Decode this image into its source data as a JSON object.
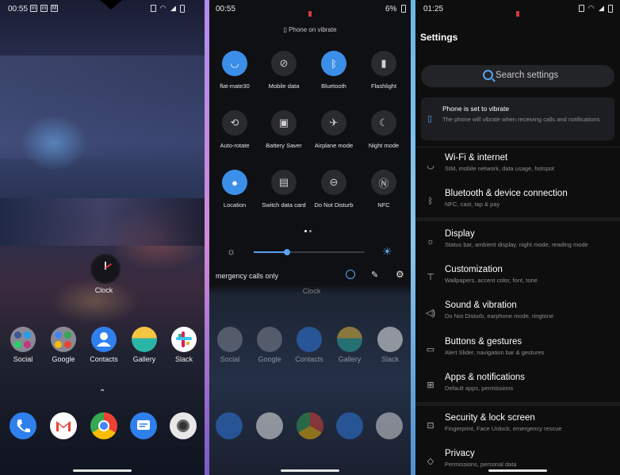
{
  "home": {
    "status": {
      "time": "00:55",
      "icons": [
        "linkedin-icon",
        "linkedin-icon",
        "gmail-icon"
      ]
    },
    "clock_label": "Clock",
    "apps": [
      {
        "label": "Social",
        "icon": "social-folder-icon"
      },
      {
        "label": "Google",
        "icon": "google-folder-icon"
      },
      {
        "label": "Contacts",
        "icon": "contacts-icon"
      },
      {
        "label": "Gallery",
        "icon": "gallery-icon"
      },
      {
        "label": "Slack",
        "icon": "slack-icon"
      }
    ],
    "dock": [
      "phone-icon",
      "gmail-icon",
      "chrome-icon",
      "messages-icon",
      "camera-icon"
    ],
    "swipe_glyph": "⌃"
  },
  "quick_settings": {
    "status": {
      "time": "00:55",
      "battery": "6%"
    },
    "vibrate_label": "Phone on vibrate",
    "tiles": [
      {
        "label": "flat-mate30",
        "on": true,
        "icon": "wifi-icon"
      },
      {
        "label": "Mobile data",
        "on": false,
        "icon": "mobile-data-icon"
      },
      {
        "label": "Bluetooth",
        "on": true,
        "icon": "bluetooth-icon"
      },
      {
        "label": "Flashlight",
        "on": false,
        "icon": "flashlight-icon"
      },
      {
        "label": "Auto-rotate",
        "on": false,
        "icon": "auto-rotate-icon"
      },
      {
        "label": "Battery Saver",
        "on": false,
        "icon": "battery-saver-icon"
      },
      {
        "label": "Airplane mode",
        "on": false,
        "icon": "airplane-icon"
      },
      {
        "label": "Night mode",
        "on": false,
        "icon": "night-mode-icon"
      },
      {
        "label": "Location",
        "on": true,
        "icon": "location-icon"
      },
      {
        "label": "Switch data card",
        "on": false,
        "icon": "sim-card-icon"
      },
      {
        "label": "Do Not Disturb",
        "on": false,
        "icon": "do-not-disturb-icon"
      },
      {
        "label": "NFC",
        "on": false,
        "icon": "nfc-icon"
      }
    ],
    "brightness_level": 0.3,
    "emergency_text": "mergency calls only",
    "clock_label": "Clock",
    "apps": [
      "Social",
      "Google",
      "Contacts",
      "Gallery",
      "Slack"
    ]
  },
  "settings": {
    "status": {
      "time": "01:25"
    },
    "title": "Settings",
    "search_placeholder": "Search settings",
    "vibrate_card": {
      "title": "Phone is set to vibrate",
      "subtitle": "The phone will vibrate when receiving calls and notifications"
    },
    "items": [
      {
        "title": "Wi-Fi & internet",
        "subtitle": "SIM, mobile network, data usage, hotspot",
        "icon": "wifi-icon"
      },
      {
        "title": "Bluetooth & device connection",
        "subtitle": "NFC, cast, tap & pay",
        "icon": "bluetooth-icon"
      },
      {
        "title": "Display",
        "subtitle": "Status bar, ambient display, night mode, reading mode",
        "icon": "brightness-icon"
      },
      {
        "title": "Customization",
        "subtitle": "Wallpapers, accent color, font, tone",
        "icon": "shirt-icon"
      },
      {
        "title": "Sound & vibration",
        "subtitle": "Do Not Disturb, earphone mode, ringtone",
        "icon": "speaker-icon"
      },
      {
        "title": "Buttons & gestures",
        "subtitle": "Alert Slider, navigation bar & gestures",
        "icon": "buttons-icon"
      },
      {
        "title": "Apps & notifications",
        "subtitle": "Default apps, permissions",
        "icon": "apps-grid-icon"
      },
      {
        "title": "Security & lock screen",
        "subtitle": "Fingerprint, Face Unlock, emergency rescue",
        "icon": "lock-icon"
      },
      {
        "title": "Privacy",
        "subtitle": "Permissions, personal data",
        "icon": "privacy-icon"
      }
    ]
  },
  "colors": {
    "accent": "#3b8fe8",
    "tile_off": "#2a2b2f",
    "background": "#0e0e0f"
  }
}
